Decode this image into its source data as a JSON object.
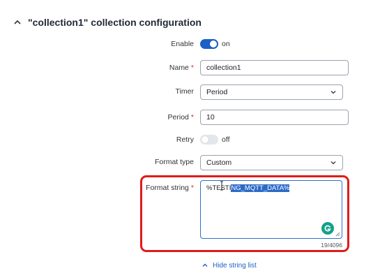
{
  "section": {
    "title": "\"collection1\" collection configuration"
  },
  "fields": {
    "enable": {
      "label": "Enable",
      "state": "on"
    },
    "name": {
      "label": "Name",
      "required_mark": "*",
      "value": "collection1"
    },
    "timer": {
      "label": "Timer",
      "value": "Period"
    },
    "period": {
      "label": "Period",
      "required_mark": "*",
      "value": "10"
    },
    "retry": {
      "label": "Retry",
      "state": "off"
    },
    "format_type": {
      "label": "Format type",
      "value": "Custom"
    },
    "format_string": {
      "label": "Format string",
      "required_mark": "*",
      "value_unselected": "%TESTI",
      "value_selected": "NG_MQTT_DATA%",
      "char_count": "19/4096"
    }
  },
  "footer": {
    "hide_link": "Hide string list"
  },
  "colors": {
    "accent": "#1b5fc7",
    "highlight": "#e01b1b",
    "required": "#e0262a",
    "grammarly": "#15a089"
  }
}
